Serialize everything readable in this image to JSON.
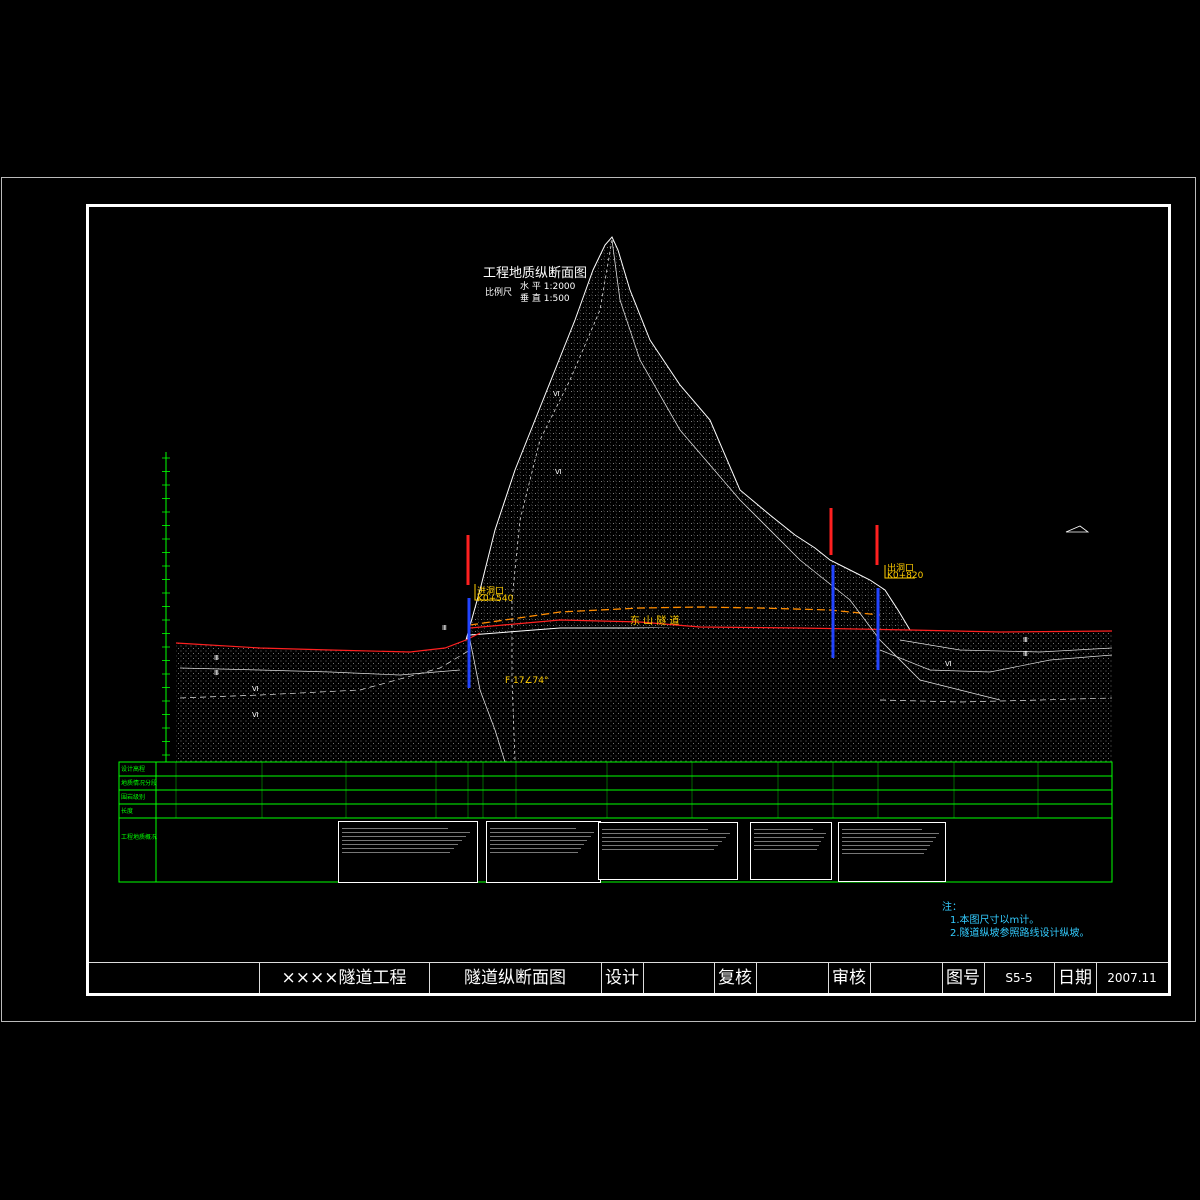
{
  "drawing": {
    "title": "工程地质纵断面图",
    "scale_label": "比例尺",
    "scale_horizontal": "水 平 1:2000",
    "scale_vertical": "垂 直 1:500",
    "tunnel_name": "东 山 隧 道",
    "entrance_label": "进洞口",
    "entrance_station": "K0+540",
    "exit_label": "出洞口",
    "exit_station": "K0+820",
    "fault_label": "F 17∠74°",
    "strata_labels": [
      "Ⅲ",
      "Ⅲ",
      "Ⅵ",
      "Ⅵ",
      "Ⅲ",
      "Ⅵ",
      "Ⅵ",
      "Ⅵ",
      "Ⅲ",
      "Ⅲ"
    ]
  },
  "table_rows": [
    "设计高程",
    "地质情况分段",
    "围岩级别",
    "长度",
    "工程地质概况"
  ],
  "table_row_indices": [
    "1",
    "2",
    "3",
    "4",
    "5"
  ],
  "notes": {
    "heading": "注：",
    "items": [
      "1.本图尺寸以m计。",
      "2.隧道纵坡参照路线设计纵坡。"
    ]
  },
  "title_block": {
    "project": "××××隧道工程",
    "drawing_name": "隧道纵断面图",
    "design_label": "设计",
    "check_label": "复核",
    "review_label": "审核",
    "drawing_no_label": "图号",
    "drawing_no": "S5-5",
    "date_label": "日期",
    "date": "2007.11"
  },
  "colors": {
    "background": "#000000",
    "axis": "#00ff00",
    "ground_line": "#ff2020",
    "tunnel_line": "#ff8000",
    "borehole": "#2244ff",
    "note_text": "#33ccff",
    "label_text": "#ffcc00"
  }
}
